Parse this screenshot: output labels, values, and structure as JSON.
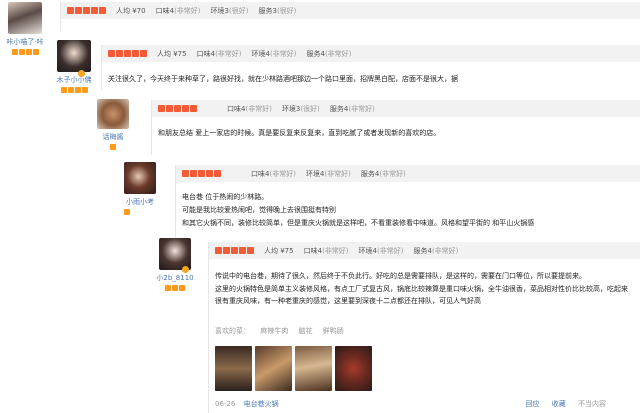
{
  "colors": {
    "star": "#f35b36",
    "header_bg": "#f2f2f2",
    "link": "#4a7ab8",
    "user_star": "#ff9a1a"
  },
  "icons": {
    "avatar_badge": "v-badge-icon"
  },
  "reviews": [
    {
      "user": "咔小喵了·咔",
      "user_stars": 4,
      "rating_stars": 5,
      "avg_label": "人均 ¥70",
      "scores": [
        {
          "label": "口味4",
          "quality": "(非常好)"
        },
        {
          "label": "环境3",
          "quality": "(很好)"
        },
        {
          "label": "服务3",
          "quality": "(很好)"
        }
      ],
      "text": []
    },
    {
      "user": "木子小小佛",
      "user_stars": 4,
      "rating_stars": 5,
      "avg_label": "人均 ¥75",
      "scores": [
        {
          "label": "口味4",
          "quality": "(非常好)"
        },
        {
          "label": "环境4",
          "quality": "(非常好)"
        },
        {
          "label": "服务4",
          "quality": "(非常好)"
        }
      ],
      "text": [
        "关注很久了，今天终于来种草了，路很好找，就在少林路酒吧那边一个路口里面，招牌黑白配，店面不是很大，据"
      ]
    },
    {
      "user": "话梅酱",
      "user_stars": 1,
      "rating_stars": 5,
      "avg_label": "",
      "scores": [
        {
          "label": "口味4",
          "quality": "(非常好)"
        },
        {
          "label": "环境3",
          "quality": "(很好)"
        },
        {
          "label": "服务4",
          "quality": "(非常好)"
        }
      ],
      "text": [
        "和朋友总结 爱上一家店的时候。真是要反复来反复来，直到吃腻了或者发现新的喜欢的店。"
      ]
    },
    {
      "user": "小雨小考",
      "user_stars": 1,
      "rating_stars": 5,
      "avg_label": "",
      "scores": [
        {
          "label": "口味4",
          "quality": "(非常好)"
        },
        {
          "label": "环境4",
          "quality": "(非常好)"
        },
        {
          "label": "服务4",
          "quality": "(非常好)"
        }
      ],
      "text": [
        "电台巷 位于热闹的少林路。",
        "可能是我比较爱热闹吧，觉得晚上去很围挺有特别",
        "和其它火锅不同，装修比较简单，但是重庆火锅就是这样吧，不看重装修看中味道。风格和望平街的 和平山火锅感"
      ]
    },
    {
      "user": "小2b_8110",
      "user_stars": 3,
      "rating_stars": 5,
      "avg_label": "人均 ¥75",
      "scores": [
        {
          "label": "口味4",
          "quality": "(非常好)"
        },
        {
          "label": "环境4",
          "quality": "(非常好)"
        },
        {
          "label": "服务4",
          "quality": "(非常好)"
        }
      ],
      "text": [
        "传说中的电台巷，期待了很久，然后终于不负此行。好吃的总是需要排队，是这样的，需要在门口等位，所以要提前来。",
        "这里的火锅特色是简单主义装修风格，有点工厂式复古风，锅底比较辣算是重口味火锅，全牛油很香，菜品相对性价比比较高，吃起来很有重庆风味，有一种老重庆的感觉，这里要到深夜十二点都还在排队，可见人气好高"
      ],
      "tags_label": "喜欢的菜：",
      "tags": [
        "麻辣牛肉",
        "脑花",
        "鲜鸭肠"
      ],
      "date": "06-26",
      "shop": "电台巷火锅",
      "actions": [
        "回应",
        "收藏",
        "不当内容"
      ]
    }
  ]
}
